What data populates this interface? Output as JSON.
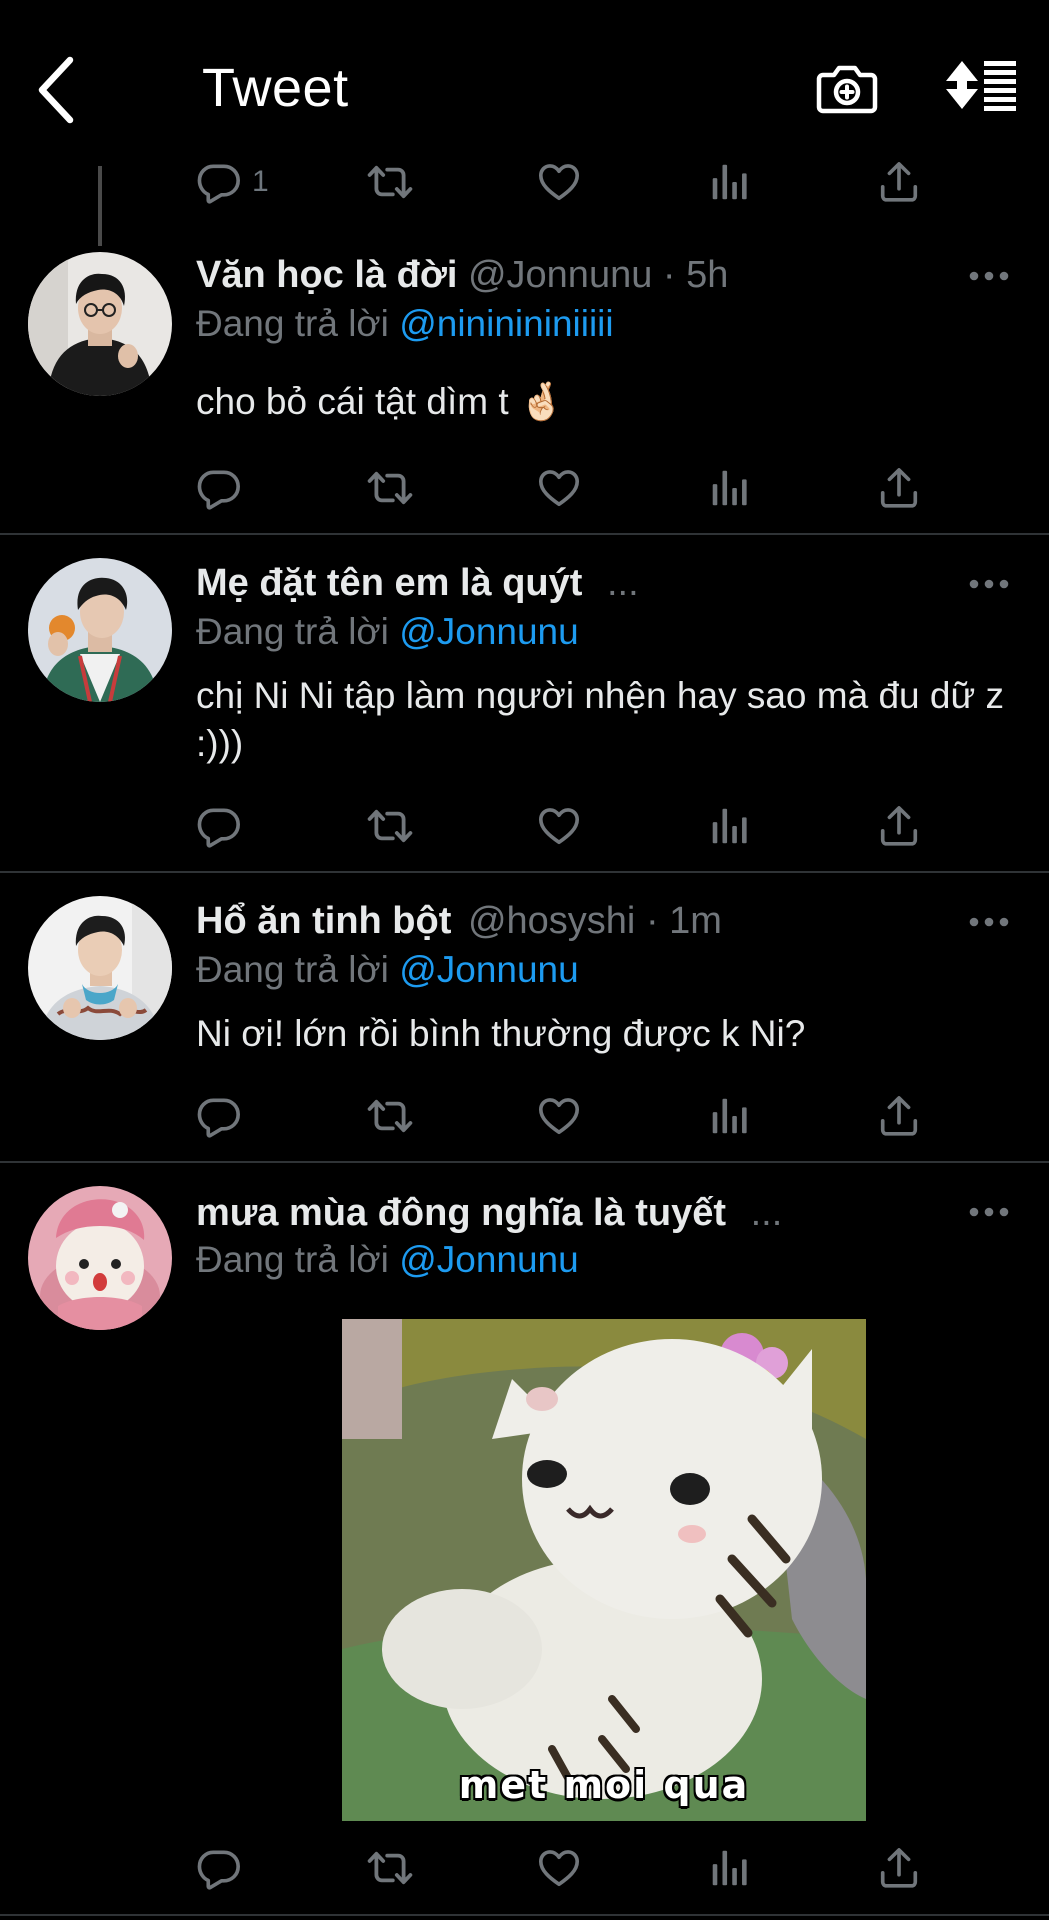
{
  "header": {
    "title": "Tweet",
    "back_icon": "chevron-left-icon",
    "camera_icon": "camera-plus-icon",
    "sort_icon": "sort-icon"
  },
  "colors": {
    "background": "#000000",
    "text": "#e7e9ea",
    "muted": "#71767b",
    "link": "#1d9bf0",
    "divider": "#2f3336"
  },
  "top_actions": {
    "reply_count": "1"
  },
  "tweets": [
    {
      "name": "Văn học là đời",
      "handle": "@Jonnunu",
      "dot": "·",
      "time": "5h",
      "truncated": "",
      "reply_prefix": "Đang trả lời",
      "reply_to": "@nininininiiiii",
      "text": "cho bỏ cái tật dìm t 🤞🏻"
    },
    {
      "name": "Mẹ đặt tên em là quýt",
      "handle": "",
      "dot": "",
      "time": "",
      "truncated": "...",
      "reply_prefix": "Đang trả lời",
      "reply_to": "@Jonnunu",
      "text": "chị Ni Ni tập làm người nhện hay sao mà đu dữ z :)))"
    },
    {
      "name": "Hổ ăn tinh bột",
      "handle": "@hosyshi",
      "dot": "·",
      "time": "1m",
      "truncated": "",
      "reply_prefix": "Đang trả lời",
      "reply_to": "@Jonnunu",
      "text": "Ni ơi! lớn rồi bình thường được k Ni?"
    },
    {
      "name": "mưa mùa đông nghĩa là tuyết",
      "handle": "",
      "dot": "",
      "time": "",
      "truncated": "...",
      "reply_prefix": "Đang trả lời",
      "reply_to": "@Jonnunu",
      "text": "",
      "media_caption": "met moi qua"
    }
  ],
  "action_icons": [
    "reply-icon",
    "retweet-icon",
    "like-icon",
    "views-icon",
    "share-icon"
  ]
}
